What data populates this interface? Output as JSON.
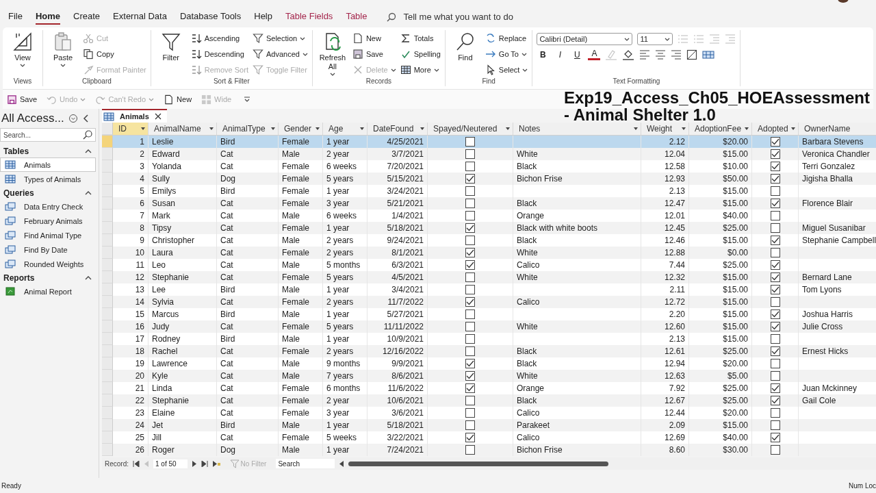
{
  "menu_tabs": [
    {
      "label": "File",
      "selected": false,
      "kind": "normal"
    },
    {
      "label": "Home",
      "selected": true,
      "kind": "normal"
    },
    {
      "label": "Create",
      "selected": false,
      "kind": "normal"
    },
    {
      "label": "External Data",
      "selected": false,
      "kind": "normal"
    },
    {
      "label": "Database Tools",
      "selected": false,
      "kind": "normal"
    },
    {
      "label": "Help",
      "selected": false,
      "kind": "normal"
    },
    {
      "label": "Table Fields",
      "selected": false,
      "kind": "context"
    },
    {
      "label": "Table",
      "selected": false,
      "kind": "context"
    }
  ],
  "tell_me": {
    "placeholder": "Tell me what you want to do"
  },
  "ribbon": [
    {
      "label": "Views",
      "items": [
        {
          "label": "View",
          "kind": "large",
          "disabled": false,
          "dropdown": true
        }
      ]
    },
    {
      "label": "Clipboard",
      "items": [
        {
          "label": "Paste",
          "kind": "large",
          "disabled": false,
          "dropdown": true
        },
        {
          "label": "Cut",
          "kind": "small",
          "disabled": true,
          "dropdown": false
        },
        {
          "label": "Copy",
          "kind": "small",
          "disabled": false,
          "dropdown": false
        },
        {
          "label": "Format Painter",
          "kind": "small",
          "disabled": true,
          "dropdown": false
        }
      ]
    },
    {
      "label": "Sort & Filter",
      "items": [
        {
          "label": "Filter",
          "kind": "large",
          "disabled": false,
          "dropdown": false
        },
        {
          "label": "Ascending",
          "kind": "small",
          "disabled": false,
          "dropdown": false
        },
        {
          "label": "Descending",
          "kind": "small",
          "disabled": false,
          "dropdown": false
        },
        {
          "label": "Remove Sort",
          "kind": "small",
          "disabled": true,
          "dropdown": false
        },
        {
          "label": "Selection",
          "kind": "small",
          "disabled": false,
          "dropdown": true
        },
        {
          "label": "Advanced",
          "kind": "small",
          "disabled": false,
          "dropdown": true
        },
        {
          "label": "Toggle Filter",
          "kind": "small",
          "disabled": true,
          "dropdown": false
        }
      ]
    },
    {
      "label": "Records",
      "items": [
        {
          "label": "Refresh All",
          "kind": "large",
          "disabled": false,
          "dropdown": true
        },
        {
          "label": "New",
          "kind": "small",
          "disabled": false,
          "dropdown": false
        },
        {
          "label": "Save",
          "kind": "small",
          "disabled": false,
          "dropdown": false
        },
        {
          "label": "Delete",
          "kind": "small",
          "disabled": true,
          "dropdown": true
        },
        {
          "label": "Totals",
          "kind": "small",
          "disabled": false,
          "dropdown": false
        },
        {
          "label": "Spelling",
          "kind": "small",
          "disabled": false,
          "dropdown": false
        },
        {
          "label": "More",
          "kind": "small",
          "disabled": false,
          "dropdown": true
        }
      ]
    },
    {
      "label": "Find",
      "items": [
        {
          "label": "Find",
          "kind": "large",
          "disabled": false,
          "dropdown": false
        },
        {
          "label": "Replace",
          "kind": "small",
          "disabled": false,
          "dropdown": false
        },
        {
          "label": "Go To",
          "kind": "small",
          "disabled": false,
          "dropdown": true
        },
        {
          "label": "Select",
          "kind": "small",
          "disabled": false,
          "dropdown": true
        }
      ]
    }
  ],
  "text_formatting": {
    "label": "Text Formatting",
    "font": "Calibri (Detail)",
    "size": "11",
    "buttons": [
      "B",
      "I",
      "U",
      "A"
    ]
  },
  "quick_access": [
    {
      "label": "Save",
      "disabled": false,
      "dropdown": false
    },
    {
      "label": "Undo",
      "disabled": true,
      "dropdown": true
    },
    {
      "label": "Can't Redo",
      "disabled": true,
      "dropdown": true
    },
    {
      "label": "New",
      "disabled": false,
      "dropdown": false
    },
    {
      "label": "Wide",
      "disabled": true,
      "dropdown": false
    }
  ],
  "caption": "Exp19_Access_Ch05_HOEAssessment - Animal Shelter 1.0",
  "sidebar": {
    "title": "All Access...",
    "search": {
      "placeholder": "Search..."
    },
    "sections": [
      {
        "label": "Tables",
        "kind": "table",
        "items": [
          {
            "label": "Animals",
            "selected": true
          },
          {
            "label": "Types of Animals",
            "selected": false
          }
        ]
      },
      {
        "label": "Queries",
        "kind": "query",
        "items": [
          {
            "label": "Data Entry Check",
            "selected": false
          },
          {
            "label": "February Animals",
            "selected": false
          },
          {
            "label": "Find Animal Type",
            "selected": false
          },
          {
            "label": "Find By Date",
            "selected": false
          },
          {
            "label": "Rounded Weights",
            "selected": false
          }
        ]
      },
      {
        "label": "Reports",
        "kind": "report",
        "items": [
          {
            "label": "Animal Report",
            "selected": false
          }
        ]
      }
    ]
  },
  "document_tab": {
    "label": "Animals"
  },
  "table": {
    "columns": [
      "ID",
      "AnimalName",
      "AnimalType",
      "Gender",
      "Age",
      "DateFound",
      "Spayed/Neutered",
      "Notes",
      "Weight",
      "AdoptionFee",
      "Adopted",
      "OwnerName"
    ],
    "rows": [
      {
        "id": "1",
        "name": "Leslie",
        "type": "Bird",
        "gender": "Female",
        "age": "1 year",
        "date": "4/25/2021",
        "spayed": false,
        "weight": "2.12",
        "fee": "$20.00",
        "adopted": true,
        "owner": "Barbara Stevens",
        "selected": true
      },
      {
        "id": "2",
        "name": "Edward",
        "type": "Cat",
        "gender": "Male",
        "age": "2 year",
        "date": "3/7/2021",
        "spayed": false,
        "notes": "White",
        "weight": "12.04",
        "fee": "$15.00",
        "adopted": true,
        "owner": "Veronica Chandler",
        "selected": false
      },
      {
        "id": "3",
        "name": "Yolanda",
        "type": "Cat",
        "gender": "Female",
        "age": "6 weeks",
        "date": "7/20/2021",
        "spayed": false,
        "notes": "Black",
        "weight": "12.58",
        "fee": "$10.00",
        "adopted": true,
        "owner": "Terri Gonzalez",
        "selected": false
      },
      {
        "id": "4",
        "name": "Sully",
        "type": "Dog",
        "gender": "Female",
        "age": "5 years",
        "date": "5/15/2021",
        "spayed": true,
        "notes": "Bichon Frise",
        "weight": "12.93",
        "fee": "$50.00",
        "adopted": true,
        "owner": "Jigisha Bhalla",
        "selected": false
      },
      {
        "id": "5",
        "name": "Emilys",
        "type": "Bird",
        "gender": "Female",
        "age": "1 year",
        "date": "3/24/2021",
        "spayed": false,
        "weight": "2.13",
        "fee": "$15.00",
        "adopted": false,
        "selected": false
      },
      {
        "id": "6",
        "name": "Susan",
        "type": "Cat",
        "gender": "Female",
        "age": "3 year",
        "date": "5/21/2021",
        "spayed": false,
        "notes": "Black",
        "weight": "12.47",
        "fee": "$15.00",
        "adopted": true,
        "owner": "Florence Blair",
        "selected": false
      },
      {
        "id": "7",
        "name": "Mark",
        "type": "Cat",
        "gender": "Male",
        "age": "6 weeks",
        "date": "1/4/2021",
        "spayed": false,
        "notes": "Orange",
        "weight": "12.01",
        "fee": "$40.00",
        "adopted": false,
        "selected": false
      },
      {
        "id": "8",
        "name": "Tipsy",
        "type": "Cat",
        "gender": "Female",
        "age": "1 year",
        "date": "5/18/2021",
        "spayed": true,
        "notes": "Black with white boots",
        "weight": "12.45",
        "fee": "$25.00",
        "adopted": false,
        "owner": "Miguel Susanibar",
        "selected": false
      },
      {
        "id": "9",
        "name": "Christopher",
        "type": "Cat",
        "gender": "Male",
        "age": "2 years",
        "date": "9/24/2021",
        "spayed": false,
        "notes": "Black",
        "weight": "12.46",
        "fee": "$15.00",
        "adopted": true,
        "owner": "Stephanie Campbell",
        "selected": false
      },
      {
        "id": "10",
        "name": "Laura",
        "type": "Cat",
        "gender": "Female",
        "age": "2 years",
        "date": "8/1/2021",
        "spayed": true,
        "notes": "White",
        "weight": "12.88",
        "fee": "$0.00",
        "adopted": false,
        "selected": false
      },
      {
        "id": "11",
        "name": "Leo",
        "type": "Cat",
        "gender": "Male",
        "age": "5 months",
        "date": "6/3/2021",
        "spayed": true,
        "notes": "Calico",
        "weight": "7.44",
        "fee": "$25.00",
        "adopted": true,
        "selected": false
      },
      {
        "id": "12",
        "name": "Stephanie",
        "type": "Cat",
        "gender": "Female",
        "age": "5 years",
        "date": "4/5/2021",
        "spayed": false,
        "notes": "White",
        "weight": "12.32",
        "fee": "$15.00",
        "adopted": true,
        "owner": "Bernard Lane",
        "selected": false
      },
      {
        "id": "13",
        "name": "Lee",
        "type": "Bird",
        "gender": "Male",
        "age": "1 year",
        "date": "3/4/2021",
        "spayed": false,
        "weight": "2.11",
        "fee": "$15.00",
        "adopted": true,
        "owner": "Tom Lyons",
        "selected": false
      },
      {
        "id": "14",
        "name": "Sylvia",
        "type": "Cat",
        "gender": "Female",
        "age": "2 years",
        "date": "11/7/2022",
        "spayed": true,
        "notes": "Calico",
        "weight": "12.72",
        "fee": "$15.00",
        "adopted": false,
        "selected": false
      },
      {
        "id": "15",
        "name": "Marcus",
        "type": "Bird",
        "gender": "Male",
        "age": "1 year",
        "date": "5/27/2021",
        "spayed": false,
        "weight": "2.20",
        "fee": "$15.00",
        "adopted": true,
        "owner": "Joshua Harris",
        "selected": false
      },
      {
        "id": "16",
        "name": "Judy",
        "type": "Cat",
        "gender": "Female",
        "age": "5 years",
        "date": "11/11/2022",
        "spayed": false,
        "notes": "White",
        "weight": "12.60",
        "fee": "$15.00",
        "adopted": true,
        "owner": "Julie Cross",
        "selected": false
      },
      {
        "id": "17",
        "name": "Rodney",
        "type": "Bird",
        "gender": "Male",
        "age": "1 year",
        "date": "10/9/2021",
        "spayed": false,
        "weight": "2.13",
        "fee": "$15.00",
        "adopted": false,
        "selected": false
      },
      {
        "id": "18",
        "name": "Rachel",
        "type": "Cat",
        "gender": "Female",
        "age": "2 years",
        "date": "12/16/2022",
        "spayed": false,
        "notes": "Black",
        "weight": "12.61",
        "fee": "$25.00",
        "adopted": true,
        "owner": "Ernest Hicks",
        "selected": false
      },
      {
        "id": "19",
        "name": "Lawrence",
        "type": "Cat",
        "gender": "Male",
        "age": "9 months",
        "date": "9/9/2021",
        "spayed": true,
        "notes": "Black",
        "weight": "12.94",
        "fee": "$20.00",
        "adopted": false,
        "selected": false
      },
      {
        "id": "20",
        "name": "Kyle",
        "type": "Cat",
        "gender": "Male",
        "age": "7 years",
        "date": "8/6/2021",
        "spayed": true,
        "notes": "White",
        "weight": "12.63",
        "fee": "$5.00",
        "adopted": false,
        "selected": false
      },
      {
        "id": "21",
        "name": "Linda",
        "type": "Cat",
        "gender": "Female",
        "age": "6 months",
        "date": "11/6/2022",
        "spayed": true,
        "notes": "Orange",
        "weight": "7.92",
        "fee": "$25.00",
        "adopted": true,
        "owner": "Juan Mckinney",
        "selected": false
      },
      {
        "id": "22",
        "name": "Stephanie",
        "type": "Cat",
        "gender": "Female",
        "age": "2 year",
        "date": "10/6/2021",
        "spayed": false,
        "notes": "Black",
        "weight": "12.67",
        "fee": "$25.00",
        "adopted": true,
        "owner": "Gail Cole",
        "selected": false
      },
      {
        "id": "23",
        "name": "Elaine",
        "type": "Cat",
        "gender": "Female",
        "age": "3 year",
        "date": "3/6/2021",
        "spayed": false,
        "notes": "Calico",
        "weight": "12.44",
        "fee": "$20.00",
        "adopted": false,
        "selected": false
      },
      {
        "id": "24",
        "name": "Jet",
        "type": "Bird",
        "gender": "Male",
        "age": "1 year",
        "date": "5/18/2021",
        "spayed": false,
        "notes": "Parakeet",
        "weight": "2.09",
        "fee": "$15.00",
        "adopted": false,
        "selected": false
      },
      {
        "id": "25",
        "name": "Jill",
        "type": "Cat",
        "gender": "Female",
        "age": "5 weeks",
        "date": "3/22/2021",
        "spayed": true,
        "notes": "Calico",
        "weight": "12.69",
        "fee": "$40.00",
        "adopted": true,
        "selected": false
      },
      {
        "id": "26",
        "name": "Roger",
        "type": "Dog",
        "gender": "Male",
        "age": "1 year",
        "date": "7/24/2021",
        "spayed": false,
        "notes": "Bichon Frise",
        "weight": "8.60",
        "fee": "$30.00",
        "adopted": false,
        "selected": false
      }
    ]
  },
  "record_nav": {
    "label": "Record:",
    "position": "1 of 50",
    "filter": "No Filter",
    "search": {
      "placeholder": "Search"
    }
  },
  "status_bar": {
    "left": "Ready",
    "right": "Num Loc"
  }
}
